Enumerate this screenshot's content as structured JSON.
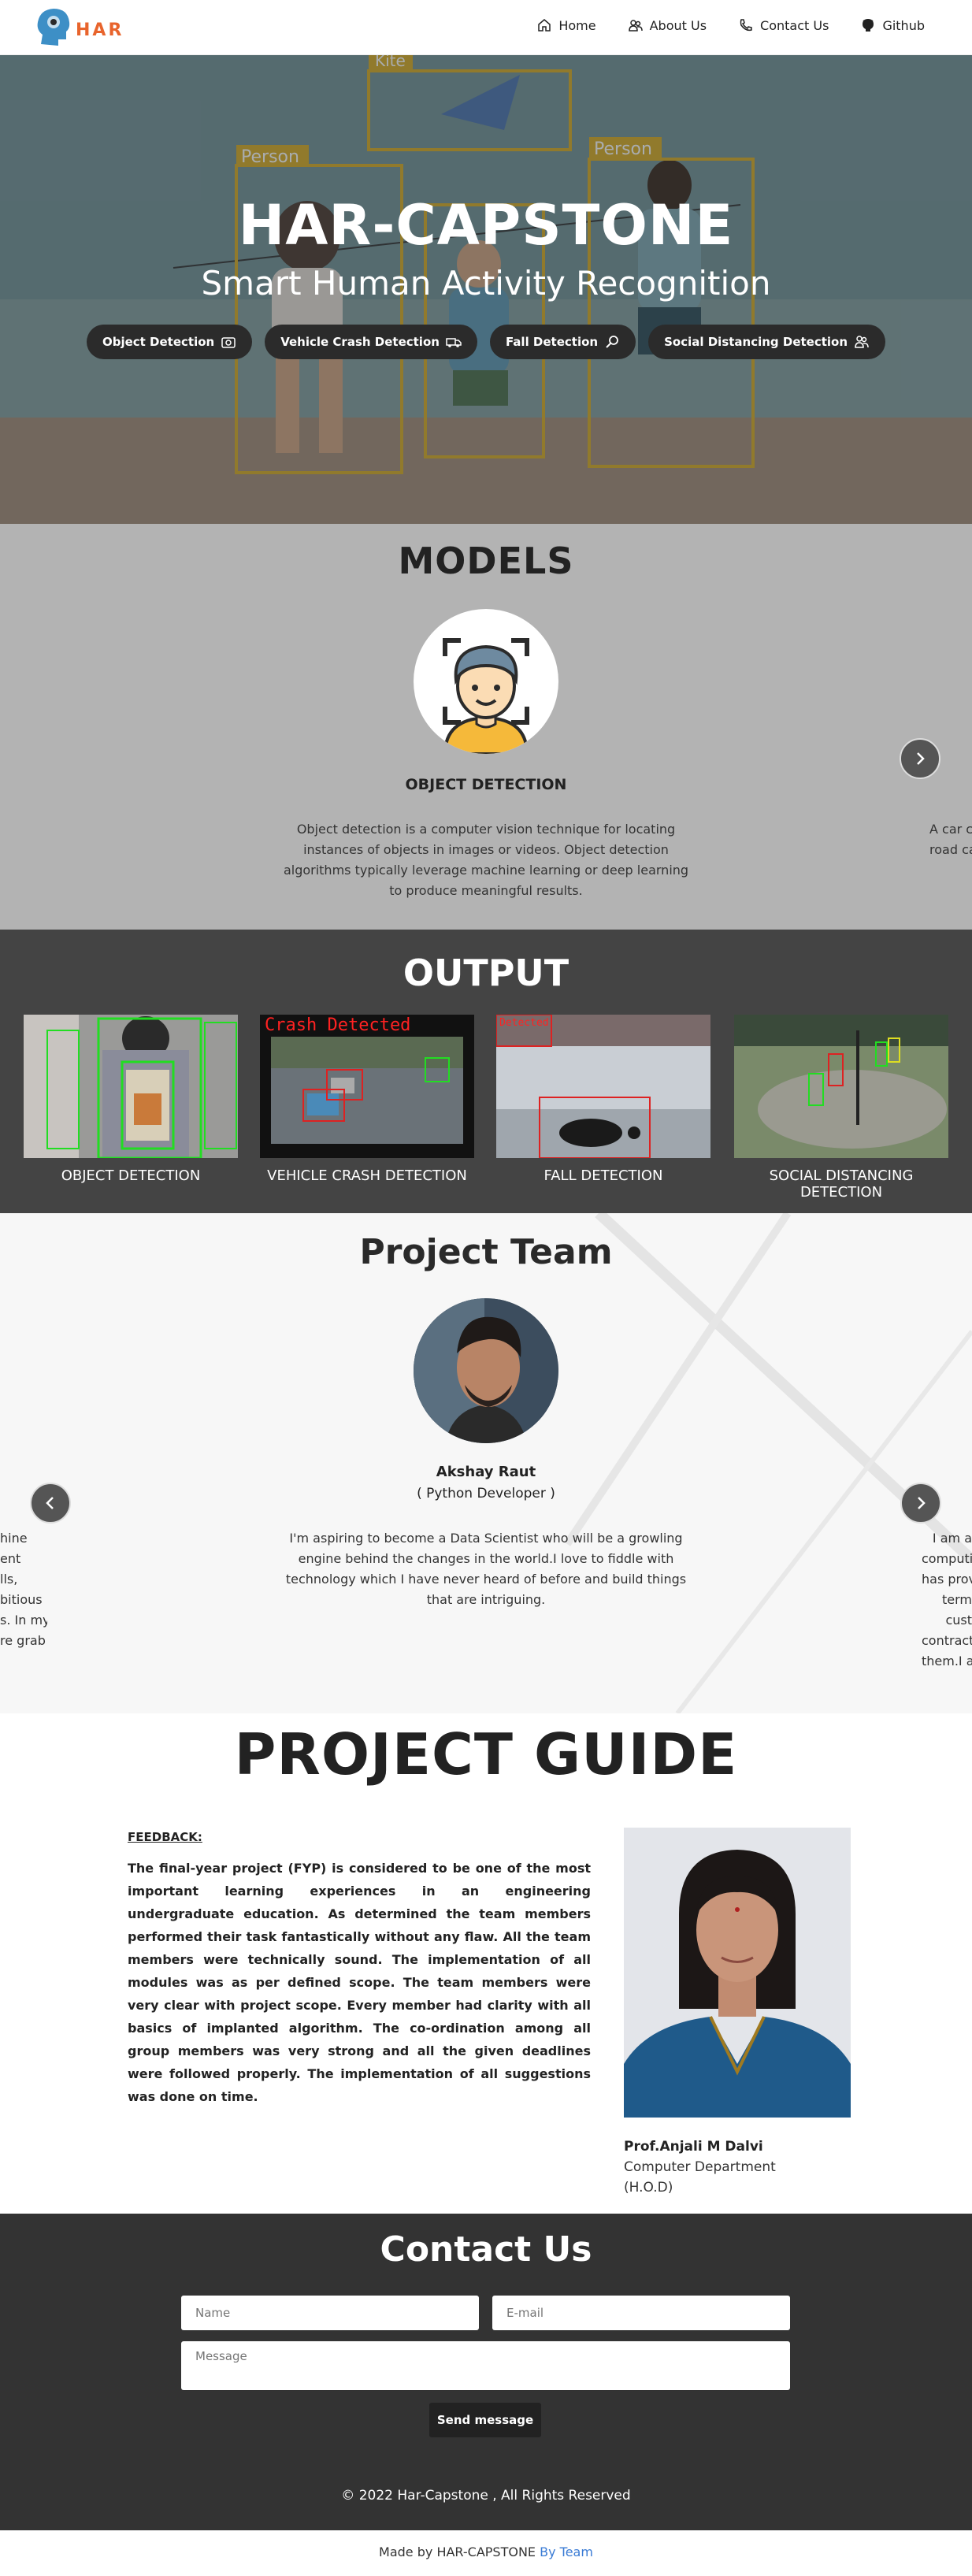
{
  "nav": {
    "logo_text": "HAR",
    "links": [
      {
        "label": "Home",
        "icon": "home-icon"
      },
      {
        "label": "About Us",
        "icon": "users-icon"
      },
      {
        "label": "Contact Us",
        "icon": "phone-icon"
      },
      {
        "label": "Github",
        "icon": "github-icon"
      }
    ]
  },
  "hero": {
    "title": "HAR-CAPSTONE",
    "subtitle": "Smart Human Activity Recognition",
    "buttons": [
      {
        "label": "Object Detection",
        "icon": "camera-icon"
      },
      {
        "label": "Vehicle Crash Detection",
        "icon": "truck-icon"
      },
      {
        "label": "Fall Detection",
        "icon": "search-icon"
      },
      {
        "label": "Social Distancing Detection",
        "icon": "people-icon"
      }
    ],
    "detections": [
      {
        "label": "Kite"
      },
      {
        "label": "Person"
      },
      {
        "label": "Person"
      }
    ]
  },
  "models": {
    "title": "MODELS",
    "current": {
      "name": "OBJECT DETECTION",
      "description": "Object detection is a computer vision technique for locating instances of objects in images or videos. Object detection algorithms typically leverage machine learning or deep learning to produce meaningful results."
    },
    "next_peek": "A car c\nroad ca"
  },
  "output": {
    "title": "OUTPUT",
    "items": [
      {
        "label": "OBJECT DETECTION"
      },
      {
        "label": "VEHICLE CRASH DETECTION",
        "overlay": "Crash Detected"
      },
      {
        "label": "FALL DETECTION",
        "overlay": "Detected"
      },
      {
        "label": "SOCIAL DISTANCING DETECTION"
      }
    ]
  },
  "team": {
    "title": "Project Team",
    "member": {
      "name": "Akshay Raut",
      "role": "( Python Developer )",
      "bio": "I'm aspiring to become a Data Scientist who will be a growling engine behind the changes in the world.I love to fiddle with technology which I have never heard of before and build things that are intriguing."
    },
    "peek_left": [
      "hine",
      "ent",
      "lls,",
      "bitious",
      "s. In my",
      "re grab"
    ],
    "peek_right": [
      "I am a",
      "computi",
      "has prov",
      "term",
      "cust",
      "contract",
      "them.I a"
    ]
  },
  "guide": {
    "title": "PROJECT GUIDE",
    "feedback_label": "FEEDBACK:",
    "feedback": "The final-year project (FYP) is considered to be one of the most important learning experiences in an engineering undergraduate education. As determined the team members performed their task fantastically without any flaw. All the team members were technically sound. The implementation of all modules was as per defined scope. The team members were very clear with project scope. Every member had clarity with all basics of implanted algorithm. The co-ordination among all group members was very strong and all the given deadlines were followed properly. The implementation of all suggestions was done on time.",
    "name": "Prof.Anjali M Dalvi",
    "department": "Computer Department",
    "position": "(H.O.D)"
  },
  "contact": {
    "title": "Contact Us",
    "name_placeholder": "Name",
    "email_placeholder": "E-mail",
    "message_placeholder": "Message",
    "send_label": "Send message",
    "copyright": "© 2022 Har-Capstone , All Rights Reserved"
  },
  "footer": {
    "made_by": "Made by HAR-CAPSTONE",
    "link": "By Team"
  },
  "colors": {
    "brand_orange": "#e8642c",
    "models_bg": "#b3b3b3",
    "output_bg": "#444444",
    "contact_bg": "#333333",
    "link_blue": "#3a7bd5"
  }
}
